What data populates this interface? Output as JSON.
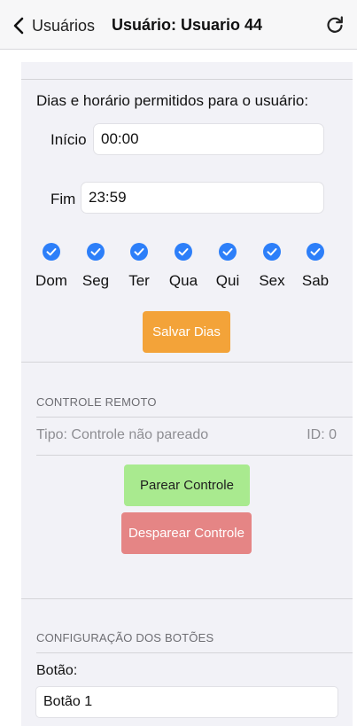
{
  "nav": {
    "back_label": "Usuários",
    "title": "Usuário: Usuario 44",
    "back_icon": "chevron-left-icon",
    "refresh_icon": "refresh-icon"
  },
  "schedule": {
    "heading": "Dias e horário permitidos para o usuário:",
    "start_label": "Início",
    "start_value": "00:00",
    "end_label": "Fim",
    "end_value": "23:59",
    "days": [
      {
        "label": "Dom",
        "checked": true
      },
      {
        "label": "Seg",
        "checked": true
      },
      {
        "label": "Ter",
        "checked": true
      },
      {
        "label": "Qua",
        "checked": true
      },
      {
        "label": "Qui",
        "checked": true
      },
      {
        "label": "Sex",
        "checked": true
      },
      {
        "label": "Sab",
        "checked": true
      }
    ],
    "save_label": "Salvar Dias"
  },
  "remote": {
    "section_title": "CONTROLE REMOTO",
    "type_text": "Tipo: Controle não pareado",
    "id_text": "ID: 0",
    "pair_label": "Parear Controle",
    "unpair_label": "Desparear Controle"
  },
  "buttons_config": {
    "section_title": "CONFIGURAÇÃO DOS BOTÕES",
    "button_label": "Botão:",
    "button_value": "Botão 1"
  },
  "colors": {
    "accent_blue": "#2d7ff9",
    "save_orange": "#f3a339",
    "pair_green": "#a9ea8f",
    "unpair_red": "#e58585",
    "panel_bg": "#f2f2f7"
  }
}
